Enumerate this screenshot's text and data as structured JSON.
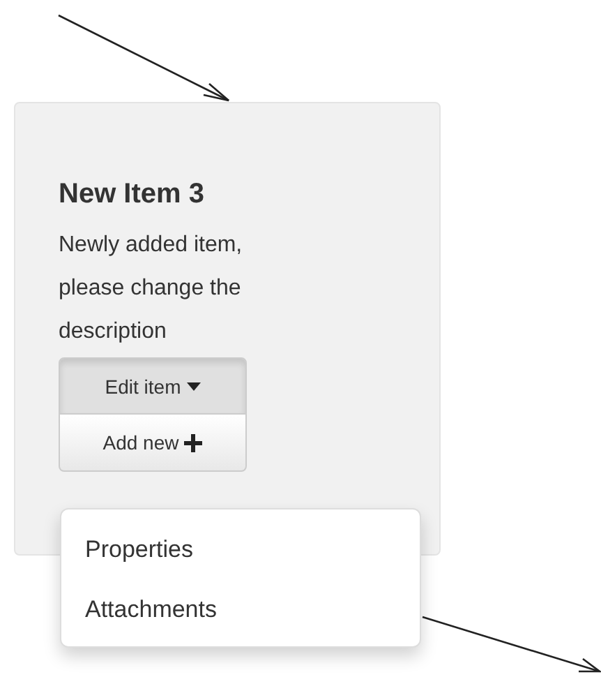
{
  "card": {
    "title": "New Item 3",
    "description": "Newly added item, please change the description",
    "edit_button": {
      "label": "Edit item",
      "expanded": true
    },
    "add_button": {
      "label": "Add new"
    },
    "menu": {
      "items": [
        {
          "label": "Properties"
        },
        {
          "label": "Attachments"
        }
      ]
    }
  }
}
